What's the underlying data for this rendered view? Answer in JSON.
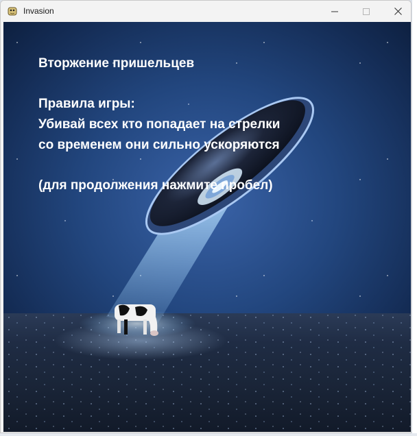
{
  "window": {
    "title": "Invasion",
    "icon": "pygame-snake-icon",
    "controls": [
      "minimize-icon",
      "maximize-icon",
      "close-icon"
    ]
  },
  "game": {
    "heading": "Вторжение пришельцев",
    "rules_title": "Правила игры:",
    "rule_1": "Убивай всех кто попадает на стрелки",
    "rule_2": "со временем они сильно ускоряются",
    "continue_hint": "(для продолжения нажмите пробел)"
  }
}
